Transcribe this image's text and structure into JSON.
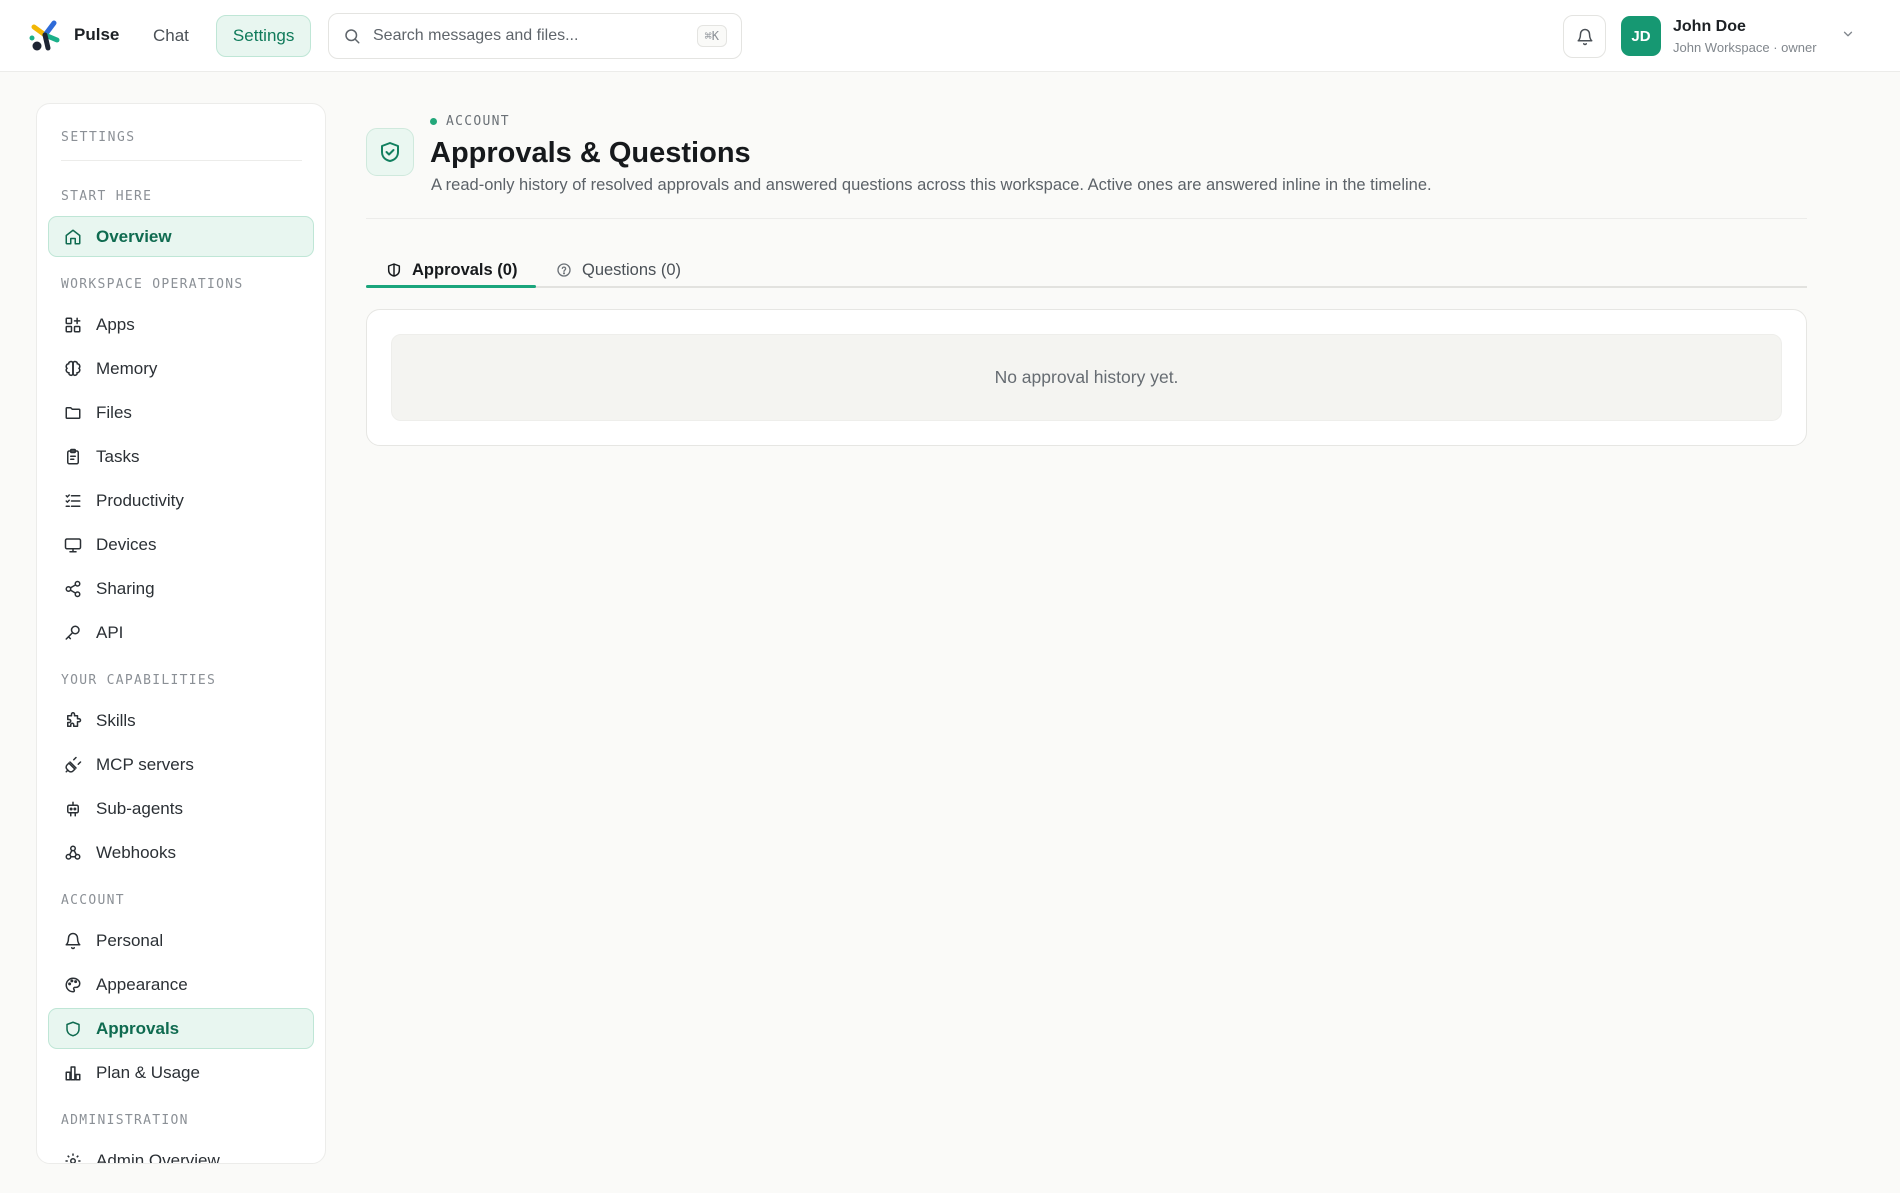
{
  "app": {
    "name": "Pulse"
  },
  "topnav": {
    "items": [
      {
        "label": "Chat"
      },
      {
        "label": "Settings"
      }
    ]
  },
  "search": {
    "placeholder": "Search messages and files...",
    "shortcut": "⌘K"
  },
  "user": {
    "initials": "JD",
    "name": "John Doe",
    "subtitle": "John Workspace · owner"
  },
  "sidebar": {
    "title": "SETTINGS",
    "sections": [
      {
        "label": "START HERE"
      },
      {
        "label": "WORKSPACE OPERATIONS"
      },
      {
        "label": "YOUR CAPABILITIES"
      },
      {
        "label": "ACCOUNT"
      },
      {
        "label": "ADMINISTRATION"
      }
    ],
    "items": [
      {
        "label": "Overview",
        "icon": "home-icon"
      },
      {
        "label": "Apps",
        "icon": "apps-icon"
      },
      {
        "label": "Memory",
        "icon": "brain-icon"
      },
      {
        "label": "Files",
        "icon": "folder-icon"
      },
      {
        "label": "Tasks",
        "icon": "clipboard-icon"
      },
      {
        "label": "Productivity",
        "icon": "list-checks-icon"
      },
      {
        "label": "Devices",
        "icon": "monitor-icon"
      },
      {
        "label": "Sharing",
        "icon": "share-icon"
      },
      {
        "label": "API",
        "icon": "key-icon"
      },
      {
        "label": "Skills",
        "icon": "puzzle-icon"
      },
      {
        "label": "MCP servers",
        "icon": "plug-icon"
      },
      {
        "label": "Sub-agents",
        "icon": "bot-icon"
      },
      {
        "label": "Webhooks",
        "icon": "webhook-icon"
      },
      {
        "label": "Personal",
        "icon": "bell-icon"
      },
      {
        "label": "Appearance",
        "icon": "palette-icon"
      },
      {
        "label": "Approvals",
        "icon": "shield-check-icon"
      },
      {
        "label": "Plan & Usage",
        "icon": "bar-chart-icon"
      },
      {
        "label": "Admin Overview",
        "icon": "gear-icon"
      }
    ]
  },
  "page": {
    "eyebrow": "ACCOUNT",
    "title": "Approvals & Questions",
    "description": "A read-only history of resolved approvals and answered questions across this workspace. Active ones are answered inline in the timeline.",
    "tabs": [
      {
        "label": "Approvals (0)"
      },
      {
        "label": "Questions (0)"
      }
    ],
    "empty_state": "No approval history yet."
  },
  "colors": {
    "accent": "#1aa57c",
    "accent_bg": "#e8f6f0",
    "avatar": "#169872"
  }
}
